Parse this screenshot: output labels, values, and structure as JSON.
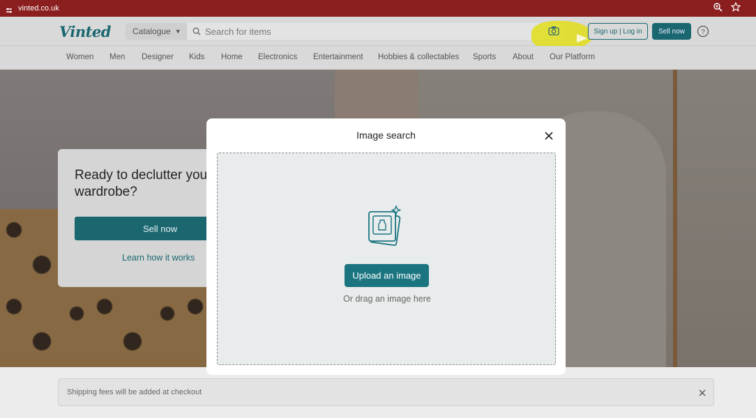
{
  "browser": {
    "url": "vinted.co.uk"
  },
  "header": {
    "logo": "Vinted",
    "catalogue_label": "Catalogue",
    "search_placeholder": "Search for items",
    "auth_label": "Sign up | Log in",
    "sell_label": "Sell now"
  },
  "nav": {
    "items": [
      "Women",
      "Men",
      "Designer",
      "Kids",
      "Home",
      "Electronics",
      "Entertainment",
      "Hobbies & collectables",
      "Sports",
      "About",
      "Our Platform"
    ]
  },
  "promo": {
    "title": "Ready to declutter your wardrobe?",
    "sell_label": "Sell now",
    "learn_label": "Learn how it works"
  },
  "shipping": {
    "text": "Shipping fees will be added at checkout"
  },
  "modal": {
    "title": "Image search",
    "upload_label": "Upload an image",
    "drag_text": "Or drag an image here"
  },
  "colors": {
    "brand": "#1a6770",
    "browser_bar": "#8b1e1e",
    "highlight": "#e2de00"
  }
}
